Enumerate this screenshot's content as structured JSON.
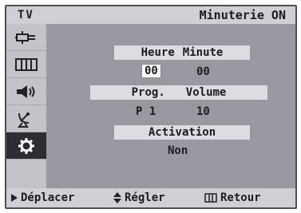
{
  "header": {
    "tv_label": "TV",
    "title": "Minuterie ON"
  },
  "sidebar": {
    "items": [
      {
        "icon": "input-plug-icon"
      },
      {
        "icon": "picture-icon"
      },
      {
        "icon": "sound-icon"
      },
      {
        "icon": "channel-antenna-icon"
      },
      {
        "icon": "setup-gear-icon",
        "active": true
      }
    ]
  },
  "timer": {
    "time_header_hour": "Heure",
    "time_header_minute": "Minute",
    "hour": "00",
    "minute": "00",
    "prog_header": "Prog.",
    "volume_header": "Volume",
    "prog": "P 1",
    "volume": "10",
    "activation_header": "Activation",
    "activation": "Non"
  },
  "footer": {
    "move": "Déplacer",
    "adjust": "Régler",
    "back": "Retour"
  },
  "colors": {
    "panel": "#b3b4ba",
    "bar": "#dcdde2",
    "active": "#2c2d33"
  }
}
